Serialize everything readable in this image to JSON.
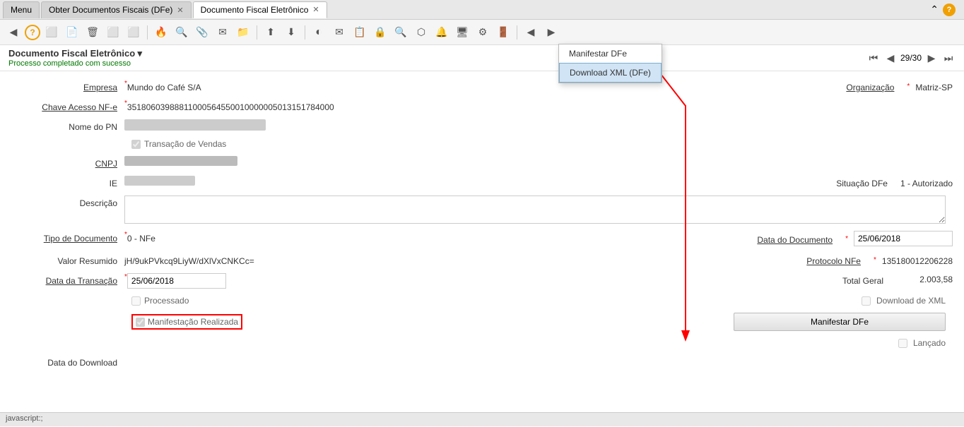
{
  "tabs": [
    {
      "label": "Menu",
      "active": false,
      "closeable": false
    },
    {
      "label": "Obter Documentos Fiscais (DFe)",
      "active": false,
      "closeable": true
    },
    {
      "label": "Documento Fiscal Eletrônico",
      "active": true,
      "closeable": true
    }
  ],
  "toolbar": {
    "icons": [
      "?",
      "□",
      "□",
      "🗑",
      "□",
      "□",
      "🔥",
      "🔍",
      "📎",
      "✉",
      "📁",
      "⬆",
      "⬇",
      "◐",
      "✉",
      "📋",
      "🔍+",
      "⚙",
      "🔔",
      "🖥",
      "⚙",
      "□",
      "◀",
      "▶"
    ]
  },
  "page": {
    "title": "Documento Fiscal Eletrônico",
    "success_message": "Processo completado com sucesso",
    "pagination": "29/30"
  },
  "dropdown_popup": {
    "items": [
      {
        "label": "Manifestar DFe",
        "highlighted": false
      },
      {
        "label": "Download XML (DFe)",
        "highlighted": true
      }
    ]
  },
  "form": {
    "empresa_label": "Empresa",
    "empresa_value": "Mundo do Café S/A",
    "organizacao_label": "Organização",
    "organizacao_value": "Matriz-SP",
    "chave_label": "Chave Acesso NF-e",
    "chave_value": "35180603988811000564550010000005013151784000",
    "nome_pn_label": "Nome do PN",
    "transacao_label": "Transação de Vendas",
    "cnpj_label": "CNPJ",
    "ie_label": "IE",
    "situacao_label": "Situação DFe",
    "situacao_value": "1 - Autorizado",
    "descricao_label": "Descrição",
    "tipo_doc_label": "Tipo de Documento",
    "tipo_doc_value": "0 - NFe",
    "data_doc_label": "Data do Documento",
    "data_doc_value": "25/06/2018",
    "valor_resumido_label": "Valor Resumido",
    "valor_resumido_value": "jH/9ukPVkcq9LiyW/dXlVxCNKCc=",
    "protocolo_label": "Protocolo NFe",
    "protocolo_value": "135180012206228",
    "data_transacao_label": "Data da Transação",
    "data_transacao_value": "25/06/2018",
    "total_geral_label": "Total Geral",
    "total_geral_value": "2.003,58",
    "processado_label": "Processado",
    "download_xml_label": "Download de XML",
    "manifestacao_label": "Manifestação Realizada",
    "manifestar_dfe_label": "Manifestar DFe",
    "lancado_label": "Lançado",
    "data_download_label": "Data do Download"
  },
  "status_bar": {
    "text": "javascript:;"
  }
}
